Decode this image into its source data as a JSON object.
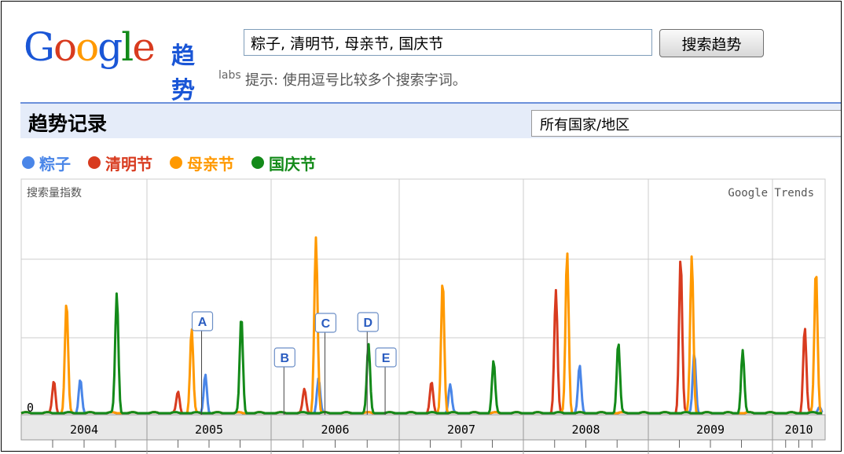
{
  "header": {
    "logo_text": "Google",
    "logo_trend": "趋势",
    "logo_labs": "labs",
    "search_value": "粽子, 清明节, 母亲节, 国庆节",
    "search_button": "搜索趋势",
    "hint": "提示: 使用逗号比较多个搜索字词。"
  },
  "section": {
    "title": "趋势记录",
    "region_select": "所有国家/地区"
  },
  "colors": {
    "粽子": "#4a86e8",
    "清明节": "#d83b1f",
    "母亲节": "#ff9900",
    "国庆节": "#138a19",
    "grid": "#cccccc"
  },
  "chart_data": {
    "type": "line",
    "title": "",
    "ylabel": "搜索量指数",
    "source_label": "Google Trends",
    "y_tick_labels": [
      "0"
    ],
    "ylim": [
      0,
      100
    ],
    "x_tick_labels": [
      "2004",
      "2005",
      "2006",
      "2007",
      "2008",
      "2009",
      "2010"
    ],
    "xlim": [
      2004.0,
      2010.4
    ],
    "grid": true,
    "legend_position": "top-left",
    "series": [
      {
        "name": "粽子",
        "peaks": [
          {
            "x": 2004.47,
            "y": 15
          },
          {
            "x": 2005.47,
            "y": 17
          },
          {
            "x": 2006.37,
            "y": 15
          },
          {
            "x": 2007.41,
            "y": 12
          },
          {
            "x": 2008.45,
            "y": 20
          },
          {
            "x": 2009.37,
            "y": 26
          },
          {
            "x": 2010.38,
            "y": 3
          }
        ]
      },
      {
        "name": "清明节",
        "peaks": [
          {
            "x": 2004.26,
            "y": 14
          },
          {
            "x": 2005.25,
            "y": 9
          },
          {
            "x": 2006.26,
            "y": 10
          },
          {
            "x": 2007.26,
            "y": 13
          },
          {
            "x": 2008.26,
            "y": 52
          },
          {
            "x": 2009.26,
            "y": 66
          },
          {
            "x": 2010.26,
            "y": 37
          }
        ]
      },
      {
        "name": "母亲节",
        "peaks": [
          {
            "x": 2004.36,
            "y": 47
          },
          {
            "x": 2005.36,
            "y": 36
          },
          {
            "x": 2006.35,
            "y": 75
          },
          {
            "x": 2007.35,
            "y": 57
          },
          {
            "x": 2008.35,
            "y": 69
          },
          {
            "x": 2009.35,
            "y": 67
          },
          {
            "x": 2010.35,
            "y": 61
          }
        ]
      },
      {
        "name": "国庆节",
        "peaks": [
          {
            "x": 2004.76,
            "y": 51
          },
          {
            "x": 2005.76,
            "y": 41
          },
          {
            "x": 2006.76,
            "y": 29
          },
          {
            "x": 2007.76,
            "y": 22
          },
          {
            "x": 2008.76,
            "y": 30
          },
          {
            "x": 2009.76,
            "y": 27
          }
        ]
      }
    ],
    "annotations": [
      {
        "label": "A",
        "x": 2005.44
      },
      {
        "label": "B",
        "x": 2006.1
      },
      {
        "label": "C",
        "x": 2006.42
      },
      {
        "label": "D",
        "x": 2006.75
      },
      {
        "label": "E",
        "x": 2006.89
      }
    ]
  }
}
